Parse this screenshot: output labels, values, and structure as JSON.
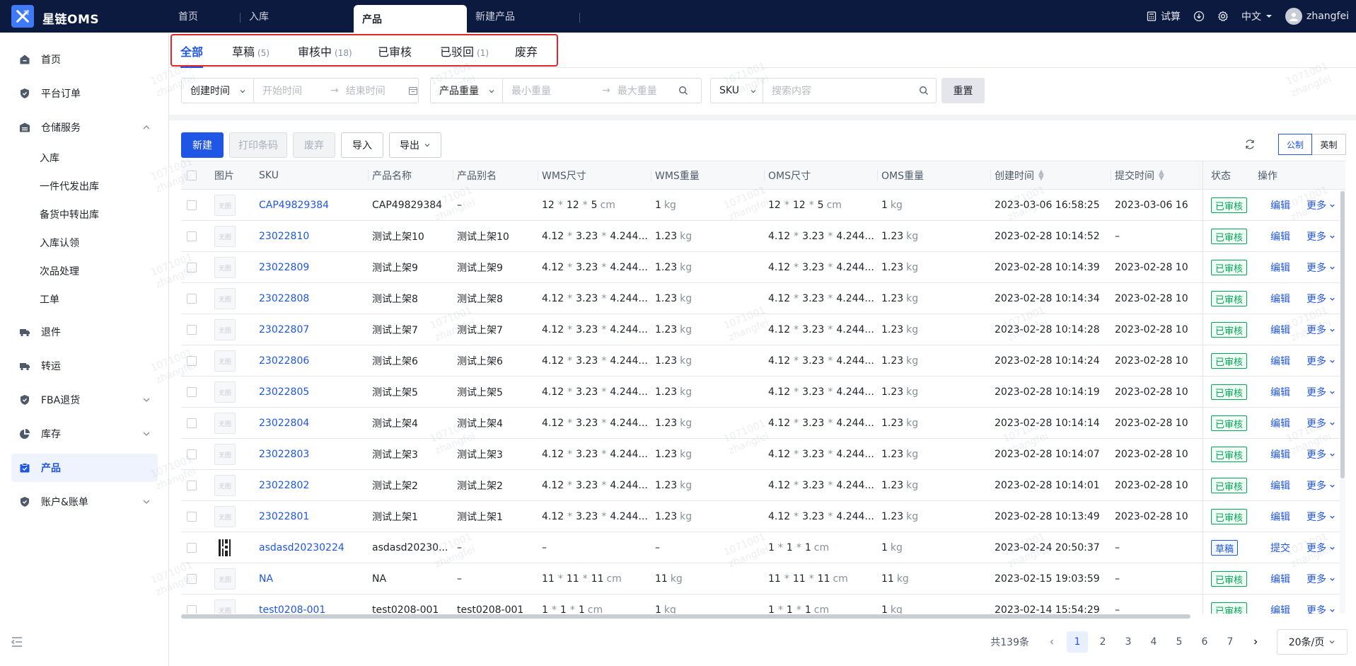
{
  "app": {
    "brand": "星链OMS"
  },
  "top_tabs": [
    {
      "label": "首页"
    },
    {
      "label": "入库"
    },
    {
      "label": "产品"
    },
    {
      "label": "新建产品"
    }
  ],
  "top_right": {
    "trial": "试算",
    "language": "中文",
    "username": "zhangfei"
  },
  "sidebar": {
    "items": [
      {
        "label": "首页"
      },
      {
        "label": "平台订单"
      },
      {
        "label": "仓储服务"
      },
      {
        "label": "退件"
      },
      {
        "label": "转运"
      },
      {
        "label": "FBA退货"
      },
      {
        "label": "库存"
      },
      {
        "label": "产品"
      },
      {
        "label": "账户&账单"
      }
    ],
    "sub_items": [
      {
        "label": "入库"
      },
      {
        "label": "一件代发出库"
      },
      {
        "label": "备货中转出库"
      },
      {
        "label": "入库认领"
      },
      {
        "label": "次品处理"
      },
      {
        "label": "工单"
      }
    ]
  },
  "status_tabs": [
    {
      "label": "全部",
      "count": ""
    },
    {
      "label": "草稿",
      "count": "(5)"
    },
    {
      "label": "审核中",
      "count": "(18)"
    },
    {
      "label": "已审核",
      "count": ""
    },
    {
      "label": "已驳回",
      "count": "(1)"
    },
    {
      "label": "废弃",
      "count": ""
    }
  ],
  "filters": {
    "date_type": "创建时间",
    "start_placeholder": "开始时间",
    "end_placeholder": "结束时间",
    "weight_type": "产品重量",
    "min_weight_placeholder": "最小重量",
    "max_weight_placeholder": "最大重量",
    "search_type": "SKU",
    "search_placeholder": "搜索内容",
    "reset": "重置"
  },
  "toolbar": {
    "new": "新建",
    "print_barcode": "打印条码",
    "discard": "废弃",
    "import": "导入",
    "export": "导出",
    "unit_metric": "公制",
    "unit_imperial": "英制"
  },
  "table": {
    "headers": {
      "image": "图片",
      "sku": "SKU",
      "name": "产品名称",
      "alias": "产品别名",
      "wms_size": "WMS尺寸",
      "wms_weight": "WMS重量",
      "oms_size": "OMS尺寸",
      "oms_weight": "OMS重量",
      "created": "创建时间",
      "submitted": "提交时间",
      "status": "状态",
      "action": "操作"
    },
    "no_image": "无图",
    "times_sign": "*",
    "cm": "cm",
    "kg": "kg",
    "more": "更多",
    "rows": [
      {
        "sku": "CAP49829384",
        "name": "CAP49829384",
        "alias": "–",
        "wms_size": [
          "12",
          "12",
          "5"
        ],
        "wms_size_trunc": false,
        "wms_weight": "1",
        "oms_size": [
          "12",
          "12",
          "5"
        ],
        "oms_size_trunc": false,
        "oms_weight": "1",
        "created": "2023-03-06 16:58:25",
        "submitted": "2023-03-06 16",
        "status": "已审核",
        "status_type": "ok",
        "action": "编辑",
        "has_image": false
      },
      {
        "sku": "23022810",
        "name": "测试上架10",
        "alias": "测试上架10",
        "wms_size": [
          "4.12",
          "3.23",
          "4.244..."
        ],
        "wms_size_trunc": true,
        "wms_weight": "1.23",
        "oms_size": [
          "4.12",
          "3.23",
          "4.244..."
        ],
        "oms_size_trunc": true,
        "oms_weight": "1.23",
        "created": "2023-02-28 10:14:52",
        "submitted": "–",
        "status": "已审核",
        "status_type": "ok",
        "action": "编辑",
        "has_image": false
      },
      {
        "sku": "23022809",
        "name": "测试上架9",
        "alias": "测试上架9",
        "wms_size": [
          "4.12",
          "3.23",
          "4.244..."
        ],
        "wms_size_trunc": true,
        "wms_weight": "1.23",
        "oms_size": [
          "4.12",
          "3.23",
          "4.244..."
        ],
        "oms_size_trunc": true,
        "oms_weight": "1.23",
        "created": "2023-02-28 10:14:39",
        "submitted": "2023-02-28 10",
        "status": "已审核",
        "status_type": "ok",
        "action": "编辑",
        "has_image": false
      },
      {
        "sku": "23022808",
        "name": "测试上架8",
        "alias": "测试上架8",
        "wms_size": [
          "4.12",
          "3.23",
          "4.244..."
        ],
        "wms_size_trunc": true,
        "wms_weight": "1.23",
        "oms_size": [
          "4.12",
          "3.23",
          "4.244..."
        ],
        "oms_size_trunc": true,
        "oms_weight": "1.23",
        "created": "2023-02-28 10:14:34",
        "submitted": "2023-02-28 10",
        "status": "已审核",
        "status_type": "ok",
        "action": "编辑",
        "has_image": false
      },
      {
        "sku": "23022807",
        "name": "测试上架7",
        "alias": "测试上架7",
        "wms_size": [
          "4.12",
          "3.23",
          "4.244..."
        ],
        "wms_size_trunc": true,
        "wms_weight": "1.23",
        "oms_size": [
          "4.12",
          "3.23",
          "4.244..."
        ],
        "oms_size_trunc": true,
        "oms_weight": "1.23",
        "created": "2023-02-28 10:14:28",
        "submitted": "2023-02-28 10",
        "status": "已审核",
        "status_type": "ok",
        "action": "编辑",
        "has_image": false
      },
      {
        "sku": "23022806",
        "name": "测试上架6",
        "alias": "测试上架6",
        "wms_size": [
          "4.12",
          "3.23",
          "4.244..."
        ],
        "wms_size_trunc": true,
        "wms_weight": "1.23",
        "oms_size": [
          "4.12",
          "3.23",
          "4.244..."
        ],
        "oms_size_trunc": true,
        "oms_weight": "1.23",
        "created": "2023-02-28 10:14:24",
        "submitted": "2023-02-28 10",
        "status": "已审核",
        "status_type": "ok",
        "action": "编辑",
        "has_image": false
      },
      {
        "sku": "23022805",
        "name": "测试上架5",
        "alias": "测试上架5",
        "wms_size": [
          "4.12",
          "3.23",
          "4.244..."
        ],
        "wms_size_trunc": true,
        "wms_weight": "1.23",
        "oms_size": [
          "4.12",
          "3.23",
          "4.244..."
        ],
        "oms_size_trunc": true,
        "oms_weight": "1.23",
        "created": "2023-02-28 10:14:19",
        "submitted": "2023-02-28 10",
        "status": "已审核",
        "status_type": "ok",
        "action": "编辑",
        "has_image": false
      },
      {
        "sku": "23022804",
        "name": "测试上架4",
        "alias": "测试上架4",
        "wms_size": [
          "4.12",
          "3.23",
          "4.244..."
        ],
        "wms_size_trunc": true,
        "wms_weight": "1.23",
        "oms_size": [
          "4.12",
          "3.23",
          "4.244..."
        ],
        "oms_size_trunc": true,
        "oms_weight": "1.23",
        "created": "2023-02-28 10:14:14",
        "submitted": "2023-02-28 10",
        "status": "已审核",
        "status_type": "ok",
        "action": "编辑",
        "has_image": false
      },
      {
        "sku": "23022803",
        "name": "测试上架3",
        "alias": "测试上架3",
        "wms_size": [
          "4.12",
          "3.23",
          "4.244..."
        ],
        "wms_size_trunc": true,
        "wms_weight": "1.23",
        "oms_size": [
          "4.12",
          "3.23",
          "4.244..."
        ],
        "oms_size_trunc": true,
        "oms_weight": "1.23",
        "created": "2023-02-28 10:14:07",
        "submitted": "2023-02-28 10",
        "status": "已审核",
        "status_type": "ok",
        "action": "编辑",
        "has_image": false
      },
      {
        "sku": "23022802",
        "name": "测试上架2",
        "alias": "测试上架2",
        "wms_size": [
          "4.12",
          "3.23",
          "4.244..."
        ],
        "wms_size_trunc": true,
        "wms_weight": "1.23",
        "oms_size": [
          "4.12",
          "3.23",
          "4.244..."
        ],
        "oms_size_trunc": true,
        "oms_weight": "1.23",
        "created": "2023-02-28 10:14:01",
        "submitted": "2023-02-28 10",
        "status": "已审核",
        "status_type": "ok",
        "action": "编辑",
        "has_image": false
      },
      {
        "sku": "23022801",
        "name": "测试上架1",
        "alias": "测试上架1",
        "wms_size": [
          "4.12",
          "3.23",
          "4.244..."
        ],
        "wms_size_trunc": true,
        "wms_weight": "1.23",
        "oms_size": [
          "4.12",
          "3.23",
          "4.244..."
        ],
        "oms_size_trunc": true,
        "oms_weight": "1.23",
        "created": "2023-02-28 10:13:49",
        "submitted": "2023-02-28 10",
        "status": "已审核",
        "status_type": "ok",
        "action": "编辑",
        "has_image": false
      },
      {
        "sku": "asdasd20230224",
        "name": "asdasd20230...",
        "alias": "–",
        "wms_size": null,
        "wms_size_text": "–",
        "wms_weight": null,
        "wms_weight_text": "–",
        "oms_size": [
          "1",
          "1",
          "1"
        ],
        "oms_size_trunc": false,
        "oms_weight": "1",
        "created": "2023-02-24 20:50:37",
        "submitted": "–",
        "status": "草稿",
        "status_type": "draft",
        "action": "提交",
        "has_image": true
      },
      {
        "sku": "NA",
        "name": "NA",
        "alias": "–",
        "wms_size": [
          "11",
          "11",
          "11"
        ],
        "wms_size_trunc": false,
        "wms_weight": "11",
        "oms_size": [
          "11",
          "11",
          "11"
        ],
        "oms_size_trunc": false,
        "oms_weight": "11",
        "created": "2023-02-15 19:03:59",
        "submitted": "–",
        "status": "已审核",
        "status_type": "ok",
        "action": "编辑",
        "has_image": false
      },
      {
        "sku": "test0208-001",
        "name": "test0208-001",
        "alias": "test0208-001",
        "wms_size": [
          "1",
          "1",
          "1"
        ],
        "wms_size_trunc": false,
        "wms_weight": "1",
        "oms_size": [
          "1",
          "1",
          "1"
        ],
        "oms_size_trunc": false,
        "oms_weight": "1",
        "created": "2023-02-14 15:54:29",
        "submitted": "–",
        "status": "已审核",
        "status_type": "ok",
        "action": "编辑",
        "has_image": false
      }
    ]
  },
  "pagination": {
    "total": "共139条",
    "pages": [
      "1",
      "2",
      "3",
      "4",
      "5",
      "6",
      "7"
    ],
    "current": "1",
    "page_size": "20条/页"
  },
  "watermark": {
    "line1": "1071001",
    "line2": "zhangfei"
  },
  "colors": {
    "primary": "#1f56e6",
    "topbar": "#0d1a40",
    "success": "#00a854",
    "highlight_box": "#e5252a"
  }
}
